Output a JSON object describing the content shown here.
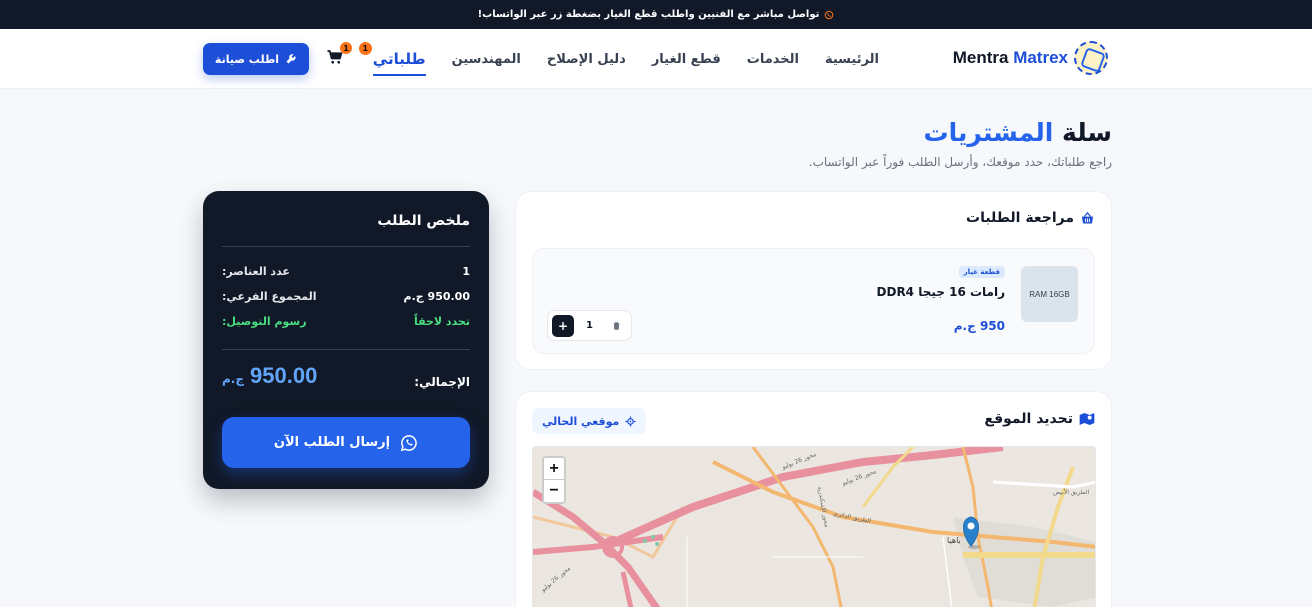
{
  "topbar": {
    "text": "تواصل مباشر مع الفنيين واطلب قطع الغيار بضغطة زر عبر الواتساب!",
    "icon": "whatsapp-icon"
  },
  "brand": {
    "name_part1": "Mentra",
    "name_part2": "Matrex"
  },
  "nav": {
    "links": [
      "الرئيسية",
      "الخدمات",
      "قطع الغيار",
      "دليل الإصلاح",
      "المهندسين",
      "طلباتي"
    ],
    "active": "طلباتي",
    "orders_badge": "1",
    "cart_badge": "1",
    "maintenance_button": "اطلب صيانة"
  },
  "page": {
    "title_part1": "سلة",
    "title_part2": "المشتريات",
    "subtitle": "راجع طلباتك، حدد موقعك، وأرسل الطلب فوراً عبر الواتساب."
  },
  "orders": {
    "title": "مراجعة الطلبات",
    "items": [
      {
        "thumb": "RAM 16GB",
        "tag": "قطعة غيار",
        "name": "رامات 16 جيجا DDR4",
        "price": "950 ج.م",
        "qty": "1"
      }
    ]
  },
  "location": {
    "title": "تحديد الموقع",
    "my_location_button": "موقعي الحالي",
    "zoom_in": "+",
    "zoom_out": "−",
    "map_label": "باهيا",
    "road_labels": [
      "محور 26 يوليو",
      "محور 26 يوليو",
      "الطريق الدائري",
      "الطريق الأبيض",
      "محور 26 يوليو",
      "محور الإسكندرية"
    ]
  },
  "summary": {
    "title": "ملخص الطلب",
    "items_count_label": "عدد العناصر:",
    "items_count": "1",
    "subtotal_label": "المجموع الفرعي:",
    "subtotal": "950.00 ج.م",
    "delivery_label": "رسوم التوصيل:",
    "delivery": "تحدد لاحقاً",
    "total_label": "الإجمالي:",
    "total": "950.00",
    "currency": "ج.م",
    "send_button": "إرسال الطلب الآن"
  },
  "colors": {
    "primary": "#1d4ed8",
    "accent": "#f97316",
    "dark": "#111827",
    "success": "#4ade80"
  }
}
